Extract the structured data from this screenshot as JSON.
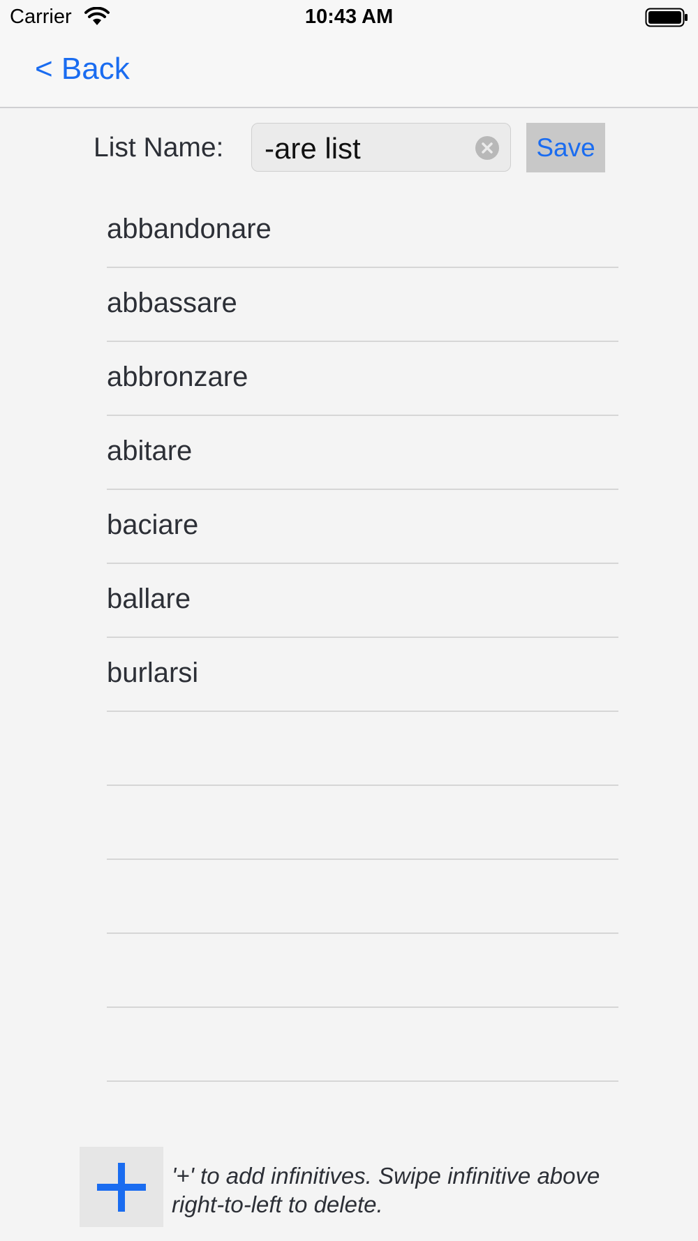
{
  "status_bar": {
    "carrier": "Carrier",
    "time": "10:43 AM",
    "wifi_icon": "wifi-icon",
    "battery_icon": "battery-icon"
  },
  "nav": {
    "back_label": "< Back"
  },
  "list_name": {
    "label": "List Name:",
    "value": "-are list",
    "clear_icon": "clear-circle-icon",
    "save_label": "Save"
  },
  "rows": [
    "abbandonare",
    "abbassare",
    "abbronzare",
    "abitare",
    "baciare",
    "ballare",
    "burlarsi",
    "",
    "",
    "",
    "",
    ""
  ],
  "footer": {
    "add_icon": "plus-icon",
    "help_text": "'+' to add infinitives. Swipe infinitive above right-to-left to delete."
  },
  "colors": {
    "accent": "#1a6cf0",
    "background": "#f4f4f4"
  }
}
